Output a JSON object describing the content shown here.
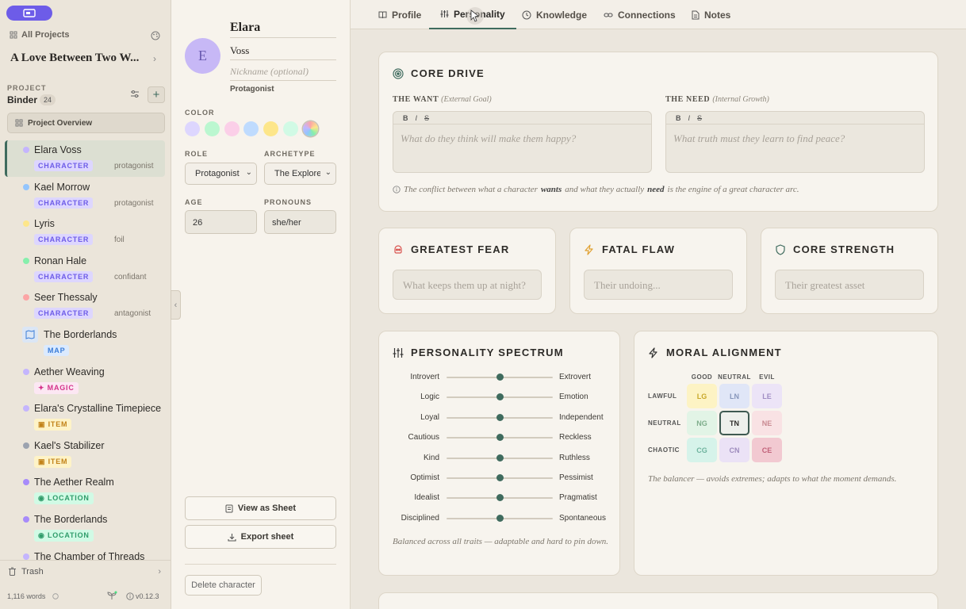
{
  "sidebar": {
    "all_projects": "All Projects",
    "project_title": "A Love Between Two W...",
    "section_label": "PROJECT",
    "binder_label": "Binder",
    "binder_count": "24",
    "overview_label": "Project Overview",
    "items": [
      {
        "name": "Elara Voss",
        "tag": "CHARACTER",
        "sub": "protagonist",
        "color": "#c4b5fd"
      },
      {
        "name": "Kael Morrow",
        "tag": "CHARACTER",
        "sub": "protagonist",
        "color": "#93c5fd"
      },
      {
        "name": "Lyris",
        "tag": "CHARACTER",
        "sub": "foil",
        "color": "#fde68a"
      },
      {
        "name": "Ronan Hale",
        "tag": "CHARACTER",
        "sub": "confidant",
        "color": "#86efac"
      },
      {
        "name": "Seer Thessaly",
        "tag": "CHARACTER",
        "sub": "antagonist",
        "color": "#fca5a5"
      },
      {
        "name": "The Borderlands",
        "tag": "MAP",
        "sub": "",
        "color": "#93c5fd"
      },
      {
        "name": "Aether Weaving",
        "tag": "MAGIC",
        "sub": "",
        "color": "#c4b5fd"
      },
      {
        "name": "Elara's Crystalline Timepiece",
        "tag": "ITEM",
        "sub": "",
        "color": "#c4b5fd"
      },
      {
        "name": "Kael's Stabilizer",
        "tag": "ITEM",
        "sub": "",
        "color": "#9ca3af"
      },
      {
        "name": "The Aether Realm",
        "tag": "LOCATION",
        "sub": "",
        "color": "#a78bfa"
      },
      {
        "name": "The Borderlands",
        "tag": "LOCATION",
        "sub": "",
        "color": "#a78bfa"
      },
      {
        "name": "The Chamber of Threads",
        "tag": "",
        "sub": "",
        "color": "#c4b5fd"
      }
    ],
    "trash_label": "Trash",
    "word_count": "1,116 words",
    "version": "v0.12.3"
  },
  "character": {
    "initial": "E",
    "first_name": "Elara",
    "last_name": "Voss",
    "nickname_placeholder": "Nickname (optional)",
    "role_caption": "Protagonist",
    "color_label": "COLOR",
    "swatches": [
      "#ddd6fe",
      "#bbf7d0",
      "#fbcfe8",
      "#bfdbfe",
      "#fde68a",
      "#d1fae5"
    ],
    "role_label": "ROLE",
    "role_value": "Protagonist",
    "archetype_label": "ARCHETYPE",
    "archetype_value": "The Explorer",
    "age_label": "AGE",
    "age_value": "26",
    "pronouns_label": "PRONOUNS",
    "pronouns_value": "she/her",
    "view_sheet": "View as Sheet",
    "export_sheet": "Export sheet",
    "delete": "Delete character"
  },
  "tabs": [
    {
      "label": "Profile",
      "icon": "book-icon"
    },
    {
      "label": "Personality",
      "icon": "sliders-icon"
    },
    {
      "label": "Knowledge",
      "icon": "brain-icon"
    },
    {
      "label": "Connections",
      "icon": "link-icon"
    },
    {
      "label": "Notes",
      "icon": "file-icon"
    }
  ],
  "core_drive": {
    "title": "CORE DRIVE",
    "want_label": "THE WANT",
    "want_hint": "(External Goal)",
    "want_placeholder": "What do they think will make them happy?",
    "need_label": "THE NEED",
    "need_hint": "(Internal Growth)",
    "need_placeholder": "What truth must they learn to find peace?",
    "toolbar": [
      "B",
      "I",
      "S"
    ],
    "tip_pre": "The conflict between what a character",
    "tip_want": "wants",
    "tip_mid": "and what they actually",
    "tip_need": "need",
    "tip_post": "is the engine of a great character arc."
  },
  "fear": {
    "title": "GREATEST FEAR",
    "placeholder": "What keeps them up at night?"
  },
  "flaw": {
    "title": "FATAL FLAW",
    "placeholder": "Their undoing..."
  },
  "strength": {
    "title": "CORE STRENGTH",
    "placeholder": "Their greatest asset"
  },
  "spectrum": {
    "title": "PERSONALITY SPECTRUM",
    "rows": [
      {
        "left": "Introvert",
        "right": "Extrovert",
        "value": 0.5
      },
      {
        "left": "Logic",
        "right": "Emotion",
        "value": 0.5
      },
      {
        "left": "Loyal",
        "right": "Independent",
        "value": 0.5
      },
      {
        "left": "Cautious",
        "right": "Reckless",
        "value": 0.5
      },
      {
        "left": "Kind",
        "right": "Ruthless",
        "value": 0.5
      },
      {
        "left": "Optimist",
        "right": "Pessimist",
        "value": 0.5
      },
      {
        "left": "Idealist",
        "right": "Pragmatist",
        "value": 0.5
      },
      {
        "left": "Disciplined",
        "right": "Spontaneous",
        "value": 0.5
      }
    ],
    "summary": "Balanced across all traits — adaptable and hard to pin down."
  },
  "alignment": {
    "title": "MORAL ALIGNMENT",
    "cols": [
      "GOOD",
      "NEUTRAL",
      "EVIL"
    ],
    "rows": [
      "LAWFUL",
      "NEUTRAL",
      "CHAOTIC"
    ],
    "cells": [
      [
        "LG",
        "LN",
        "LE"
      ],
      [
        "NG",
        "TN",
        "NE"
      ],
      [
        "CG",
        "CN",
        "CE"
      ]
    ],
    "selected": "TN",
    "description": "The balancer — avoids extremes; adapts to what the moment demands."
  },
  "colors": {
    "accent": "#3f6b5e",
    "purple": "#6d5ce8"
  }
}
